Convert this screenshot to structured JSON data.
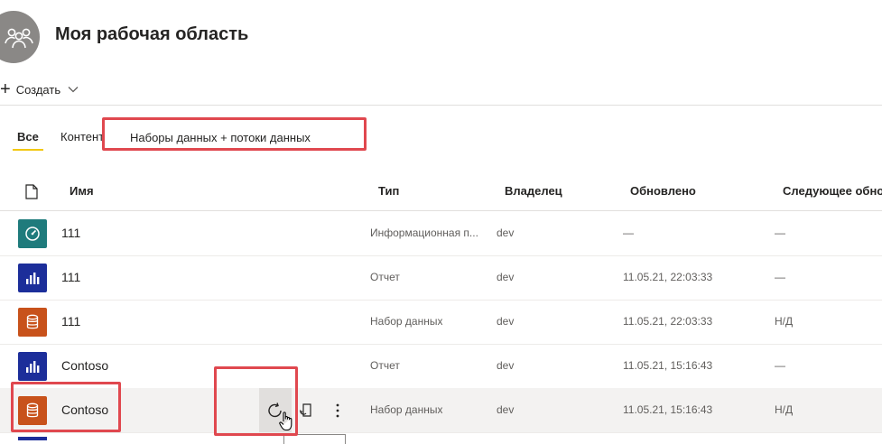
{
  "workspace": {
    "title": "Моя рабочая область"
  },
  "toolbar": {
    "create_label": "Создать"
  },
  "tabs": [
    {
      "label": "Все",
      "active": true
    },
    {
      "label": "Контент",
      "active": false
    },
    {
      "label": "Наборы данных + потоки данных",
      "active": false
    }
  ],
  "table": {
    "headers": {
      "name": "Имя",
      "type": "Тип",
      "owner": "Владелец",
      "updated": "Обновлено",
      "next": "Следующее обно"
    },
    "rows": [
      {
        "icon": "dashboard-icon",
        "icon_color": "#1f7b7c",
        "name": "111",
        "type": "Информационная п...",
        "owner": "dev",
        "updated": "—",
        "next": "—"
      },
      {
        "icon": "report-icon",
        "icon_color": "#1c2e9a",
        "name": "111",
        "type": "Отчет",
        "owner": "dev",
        "updated": "11.05.21, 22:03:33",
        "next": "—"
      },
      {
        "icon": "dataset-icon",
        "icon_color": "#c8521b",
        "name": "111",
        "type": "Набор данных",
        "owner": "dev",
        "updated": "11.05.21, 22:03:33",
        "next": "Н/Д"
      },
      {
        "icon": "report-icon",
        "icon_color": "#1c2e9a",
        "name": "Contoso",
        "type": "Отчет",
        "owner": "dev",
        "updated": "11.05.21, 15:16:43",
        "next": "—"
      },
      {
        "icon": "dataset-icon",
        "icon_color": "#c8521b",
        "name": "Contoso",
        "type": "Набор данных",
        "owner": "dev",
        "updated": "11.05.21, 15:16:43",
        "next": "Н/Д"
      }
    ]
  },
  "colors": {
    "accent_underline": "#f2c811",
    "highlight_box": "#e0484f",
    "hover_row": "#f3f2f1"
  }
}
